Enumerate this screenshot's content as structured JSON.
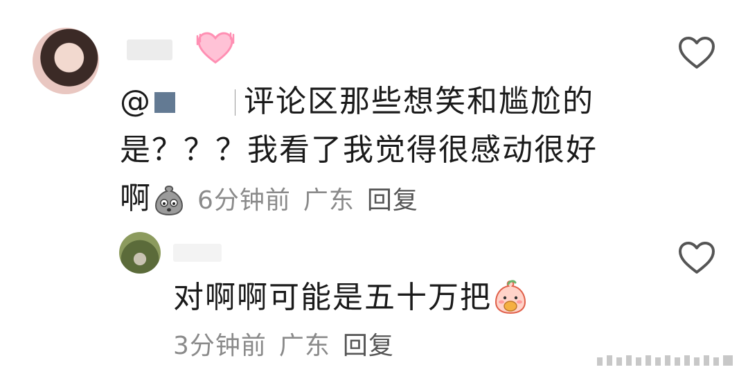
{
  "comment": {
    "mention_prefix": "@",
    "text_line1": "评论区那些想笑和尴尬的",
    "text_line2": "是？？？我看了我觉得很感动很好",
    "text_line3": "啊",
    "emoji": "sack-face-emoji",
    "time": "6分钟前",
    "location": "广东",
    "reply_label": "回复",
    "badge_icon": "sparkling-heart-icon",
    "like_icon": "heart-outline-icon"
  },
  "reply": {
    "text": "对啊啊可能是五十万把",
    "emoji": "peach-eating-emoji",
    "time": "3分钟前",
    "location": "广东",
    "reply_label": "回复",
    "like_icon": "heart-outline-icon"
  },
  "colors": {
    "text": "#1a1a1a",
    "meta": "#8a8a8a",
    "heart_badge": "#ff8fb3",
    "like_outline": "#555555"
  }
}
